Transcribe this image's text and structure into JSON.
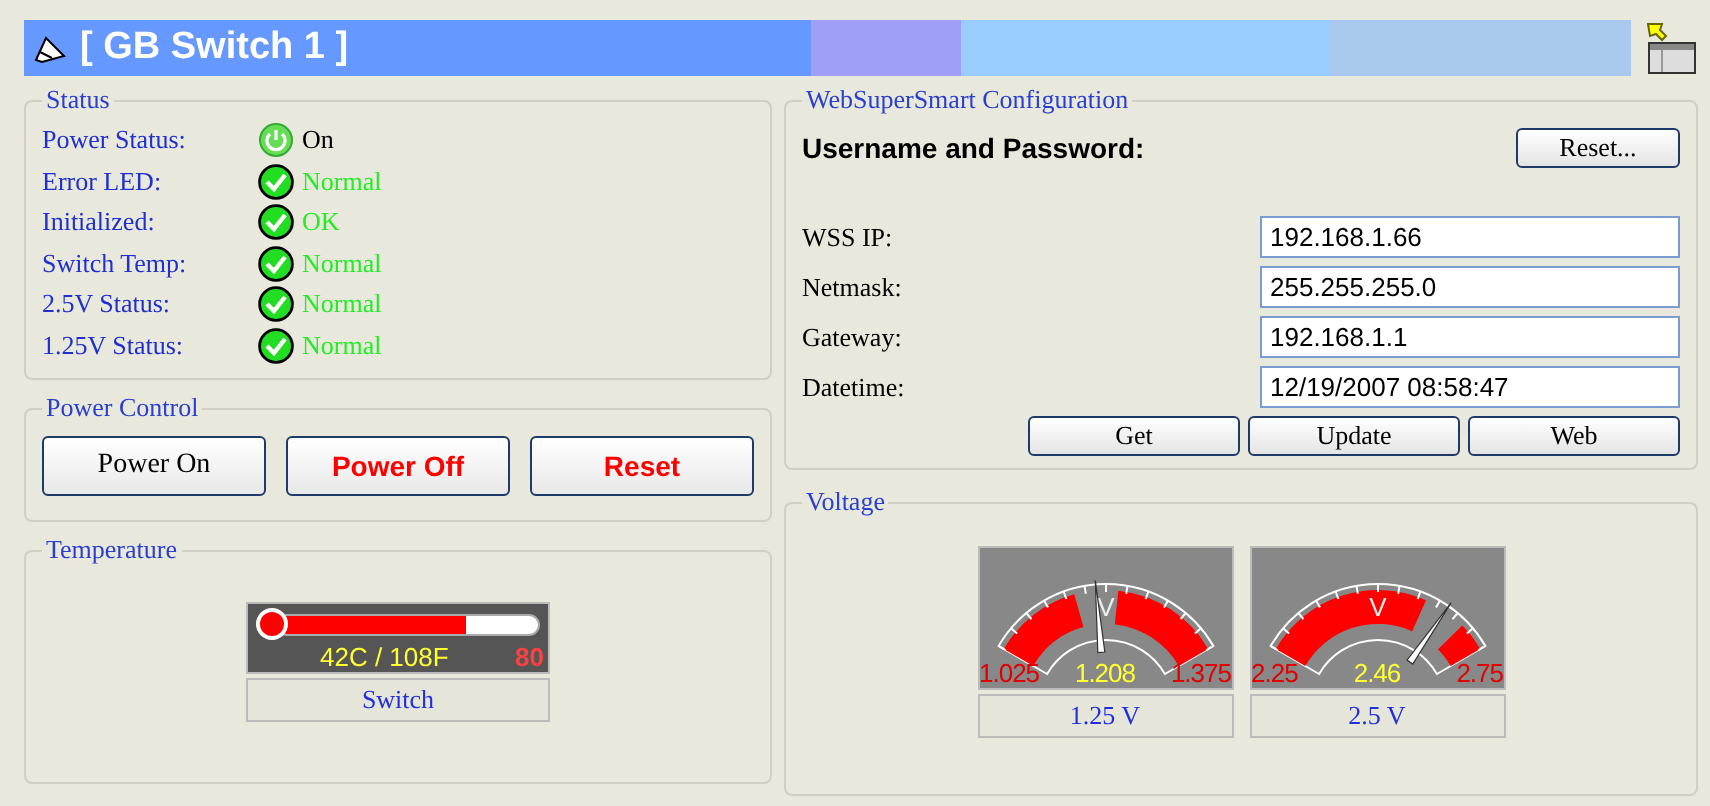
{
  "window": {
    "title": "[ GB Switch 1 ]"
  },
  "status": {
    "title": "Status",
    "rows": [
      {
        "label": "Power Status:",
        "kind": "power",
        "value": "On"
      },
      {
        "label": "Error LED:",
        "kind": "check",
        "value": "Normal"
      },
      {
        "label": "Initialized:",
        "kind": "check",
        "value": "OK"
      },
      {
        "label": "Switch Temp:",
        "kind": "check",
        "value": "Normal"
      },
      {
        "label": "2.5V Status:",
        "kind": "check",
        "value": "Normal"
      },
      {
        "label": "1.25V Status:",
        "kind": "check",
        "value": "Normal"
      }
    ]
  },
  "power_control": {
    "title": "Power Control",
    "buttons": [
      {
        "label": "Power On",
        "kind": "normal"
      },
      {
        "label": "Power Off",
        "kind": "danger"
      },
      {
        "label": "Reset",
        "kind": "danger"
      }
    ]
  },
  "temperature": {
    "title": "Temperature",
    "reading": "42C / 108F",
    "max": "80",
    "level": 0.72,
    "caption": "Switch"
  },
  "config": {
    "title": "WebSuperSmart Configuration",
    "credentials_label": "Username and Password:",
    "reset_button": "Reset...",
    "fields": [
      {
        "label": "WSS IP:",
        "value": "192.168.1.66"
      },
      {
        "label": "Netmask:",
        "value": "255.255.255.0"
      },
      {
        "label": "Gateway:",
        "value": "192.168.1.1"
      },
      {
        "label": "Datetime:",
        "value": "12/19/2007 08:58:47"
      }
    ],
    "buttons": [
      "Get",
      "Update",
      "Web"
    ]
  },
  "voltage": {
    "title": "Voltage",
    "gauges": [
      {
        "min": "1.025",
        "value": "1.208",
        "max": "1.375",
        "unit": "V",
        "level": 0.46,
        "caption": "1.25 V"
      },
      {
        "min": "2.25",
        "value": "2.46",
        "max": "2.75",
        "unit": "V",
        "level": 0.79,
        "caption": "2.5 V"
      }
    ]
  }
}
